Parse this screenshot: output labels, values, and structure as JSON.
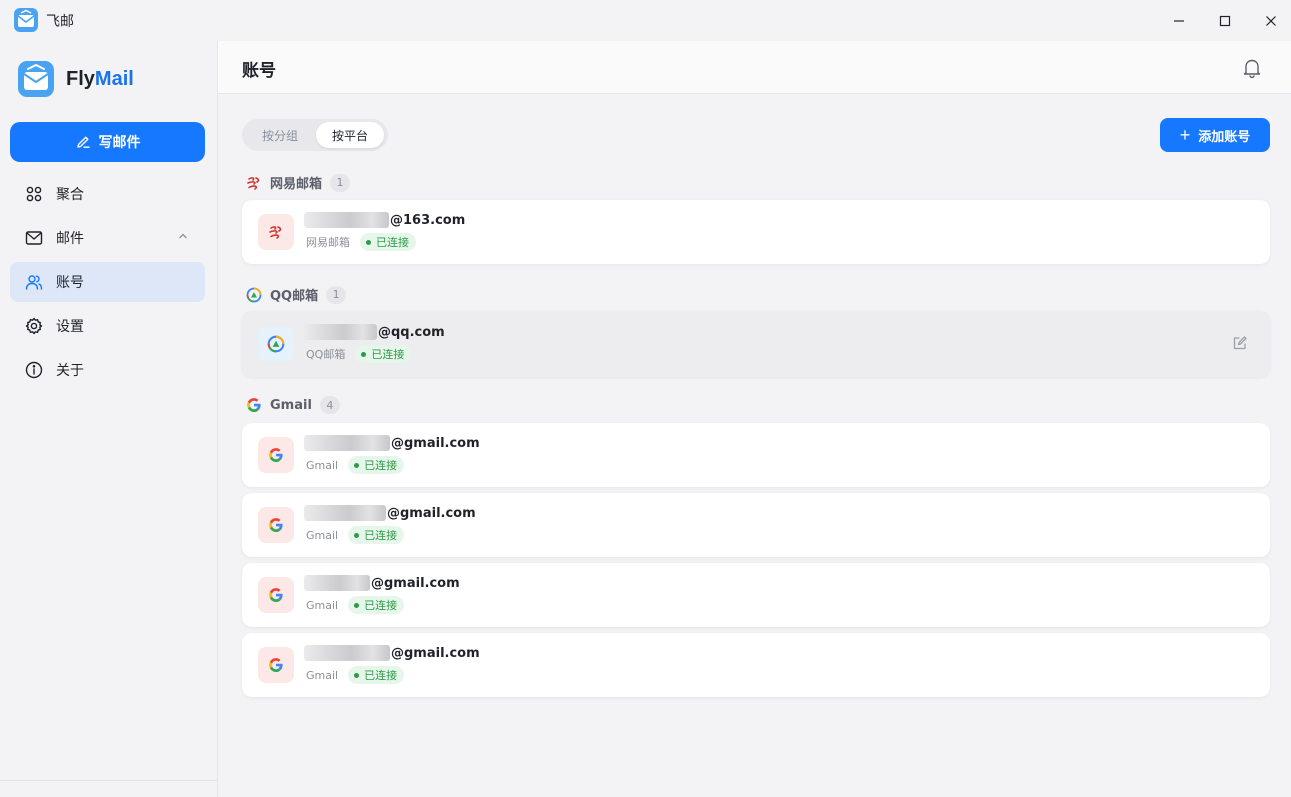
{
  "window": {
    "title": "飞邮"
  },
  "sidebar": {
    "brand": {
      "fly": "Fly",
      "mail": "Mail"
    },
    "compose_label": "写邮件",
    "items": [
      {
        "label": "聚合",
        "icon": "aggregate-icon"
      },
      {
        "label": "邮件",
        "icon": "mail-icon",
        "expanded": true
      },
      {
        "label": "账号",
        "icon": "users-icon",
        "active": true
      },
      {
        "label": "设置",
        "icon": "gear-icon"
      },
      {
        "label": "关于",
        "icon": "info-icon"
      }
    ]
  },
  "header": {
    "title": "账号"
  },
  "toolbar": {
    "segments": [
      "按分组",
      "按平台"
    ],
    "selected_segment": "按平台",
    "add_account_label": "添加账号"
  },
  "groups": [
    {
      "name": "网易邮箱",
      "count": "1",
      "accounts": [
        {
          "email_suffix": "@163.com",
          "platform": "网易邮箱",
          "status": "已连接"
        }
      ]
    },
    {
      "name": "QQ邮箱",
      "count": "1",
      "accounts": [
        {
          "email_suffix": "@qq.com",
          "platform": "QQ邮箱",
          "status": "已连接"
        }
      ]
    },
    {
      "name": "Gmail",
      "count": "4",
      "accounts": [
        {
          "email_suffix": "@gmail.com",
          "platform": "Gmail",
          "status": "已连接"
        },
        {
          "email_suffix": "@gmail.com",
          "platform": "Gmail",
          "status": "已连接"
        },
        {
          "email_suffix": "@gmail.com",
          "platform": "Gmail",
          "status": "已连接"
        },
        {
          "email_suffix": "@gmail.com",
          "platform": "Gmail",
          "status": "已连接"
        }
      ]
    }
  ],
  "colors": {
    "accent": "#1677ff",
    "active_nav": "#dde7f8",
    "connected": "#2e9a4a",
    "connected_bg": "#e7f6ea",
    "netease_red": "#d0342c"
  }
}
